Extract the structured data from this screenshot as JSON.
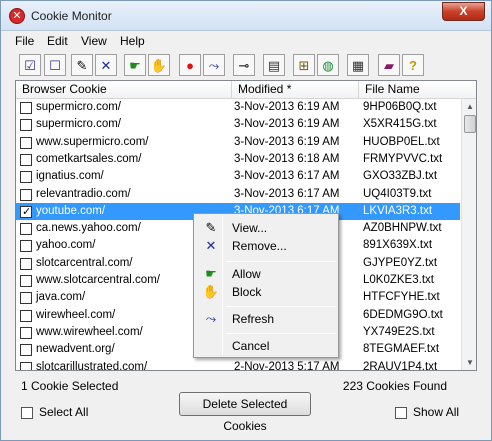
{
  "window": {
    "title": "Cookie Monitor",
    "close_glyph": "X"
  },
  "menu": [
    "File",
    "Edit",
    "View",
    "Help"
  ],
  "toolbar": [
    {
      "name": "check-all-icon",
      "glyph": "☑"
    },
    {
      "name": "uncheck-all-icon",
      "glyph": "☐"
    },
    {
      "name": "edit-icon",
      "glyph": "✎"
    },
    {
      "name": "delete-icon",
      "glyph": "✕"
    },
    {
      "name": "allow-icon",
      "glyph": "☛"
    },
    {
      "name": "block-icon",
      "glyph": "✋"
    },
    {
      "name": "record-icon",
      "glyph": "●"
    },
    {
      "name": "refresh-icon",
      "glyph": "⤳"
    },
    {
      "name": "pin-icon",
      "glyph": "⊸"
    },
    {
      "name": "view-icon",
      "glyph": "▤"
    },
    {
      "name": "tree-icon",
      "glyph": "⊞"
    },
    {
      "name": "globe-icon",
      "glyph": "◍"
    },
    {
      "name": "properties-icon",
      "glyph": "▦"
    },
    {
      "name": "book-icon",
      "glyph": "▰"
    },
    {
      "name": "help-icon",
      "glyph": "?"
    }
  ],
  "list": {
    "headers": [
      "Browser Cookie",
      "Modified *",
      "File Name"
    ],
    "rows": [
      {
        "cookie": "supermicro.com/",
        "modified": "3-Nov-2013 6:19 AM",
        "file": "9HP06B0Q.txt",
        "checked": false,
        "selected": false
      },
      {
        "cookie": "supermicro.com/",
        "modified": "3-Nov-2013 6:19 AM",
        "file": "X5XR415G.txt",
        "checked": false,
        "selected": false
      },
      {
        "cookie": "www.supermicro.com/",
        "modified": "3-Nov-2013 6:19 AM",
        "file": "HUOBP0EL.txt",
        "checked": false,
        "selected": false
      },
      {
        "cookie": "cometkartsales.com/",
        "modified": "3-Nov-2013 6:18 AM",
        "file": "FRMYPVVC.txt",
        "checked": false,
        "selected": false
      },
      {
        "cookie": "ignatius.com/",
        "modified": "3-Nov-2013 6:17 AM",
        "file": "GXO33ZBJ.txt",
        "checked": false,
        "selected": false
      },
      {
        "cookie": "relevantradio.com/",
        "modified": "3-Nov-2013 6:17 AM",
        "file": "UQ4I03T9.txt",
        "checked": false,
        "selected": false
      },
      {
        "cookie": "youtube.com/",
        "modified": "3-Nov-2013 6:17 AM",
        "file": "LKVIA3R3.txt",
        "checked": true,
        "selected": true
      },
      {
        "cookie": "ca.news.yahoo.com/",
        "modified": "",
        "file": "AZ0BHNPW.txt",
        "checked": false,
        "selected": false
      },
      {
        "cookie": "yahoo.com/",
        "modified": "",
        "file": "891X639X.txt",
        "checked": false,
        "selected": false
      },
      {
        "cookie": "slotcarcentral.com/",
        "modified": "",
        "file": "GJYPE0YZ.txt",
        "checked": false,
        "selected": false
      },
      {
        "cookie": "www.slotcarcentral.com/",
        "modified": "",
        "file": "L0K0ZKE3.txt",
        "checked": false,
        "selected": false
      },
      {
        "cookie": "java.com/",
        "modified": "",
        "file": "HTFCFYHE.txt",
        "checked": false,
        "selected": false
      },
      {
        "cookie": "wirewheel.com/",
        "modified": "",
        "file": "6DEDMG9O.txt",
        "checked": false,
        "selected": false
      },
      {
        "cookie": "www.wirewheel.com/",
        "modified": "",
        "file": "YX749E2S.txt",
        "checked": false,
        "selected": false
      },
      {
        "cookie": "newadvent.org/",
        "modified": "",
        "file": "8TEGMAEF.txt",
        "checked": false,
        "selected": false
      },
      {
        "cookie": "slotcarillustrated.com/",
        "modified": "2-Nov-2013 5:17 AM",
        "file": "2RAUV1P4.txt",
        "checked": false,
        "selected": false
      }
    ]
  },
  "context_menu": [
    {
      "label": "View...",
      "icon": "edit-icon",
      "glyph": "✎"
    },
    {
      "label": "Remove...",
      "icon": "remove-icon",
      "glyph": "✕"
    },
    {
      "label": "Allow",
      "icon": "allow-icon",
      "glyph": "☛"
    },
    {
      "label": "Block",
      "icon": "block-icon",
      "glyph": "✋"
    },
    {
      "label": "Refresh",
      "icon": "refresh-icon",
      "glyph": "⤳"
    },
    {
      "label": "Cancel",
      "icon": "",
      "glyph": ""
    }
  ],
  "status": {
    "selected_text": "1 Cookie Selected",
    "found_text": "223 Cookies Found"
  },
  "footer": {
    "select_all": "Select All",
    "delete_button": "Delete Selected Cookies",
    "show_all": "Show All"
  }
}
